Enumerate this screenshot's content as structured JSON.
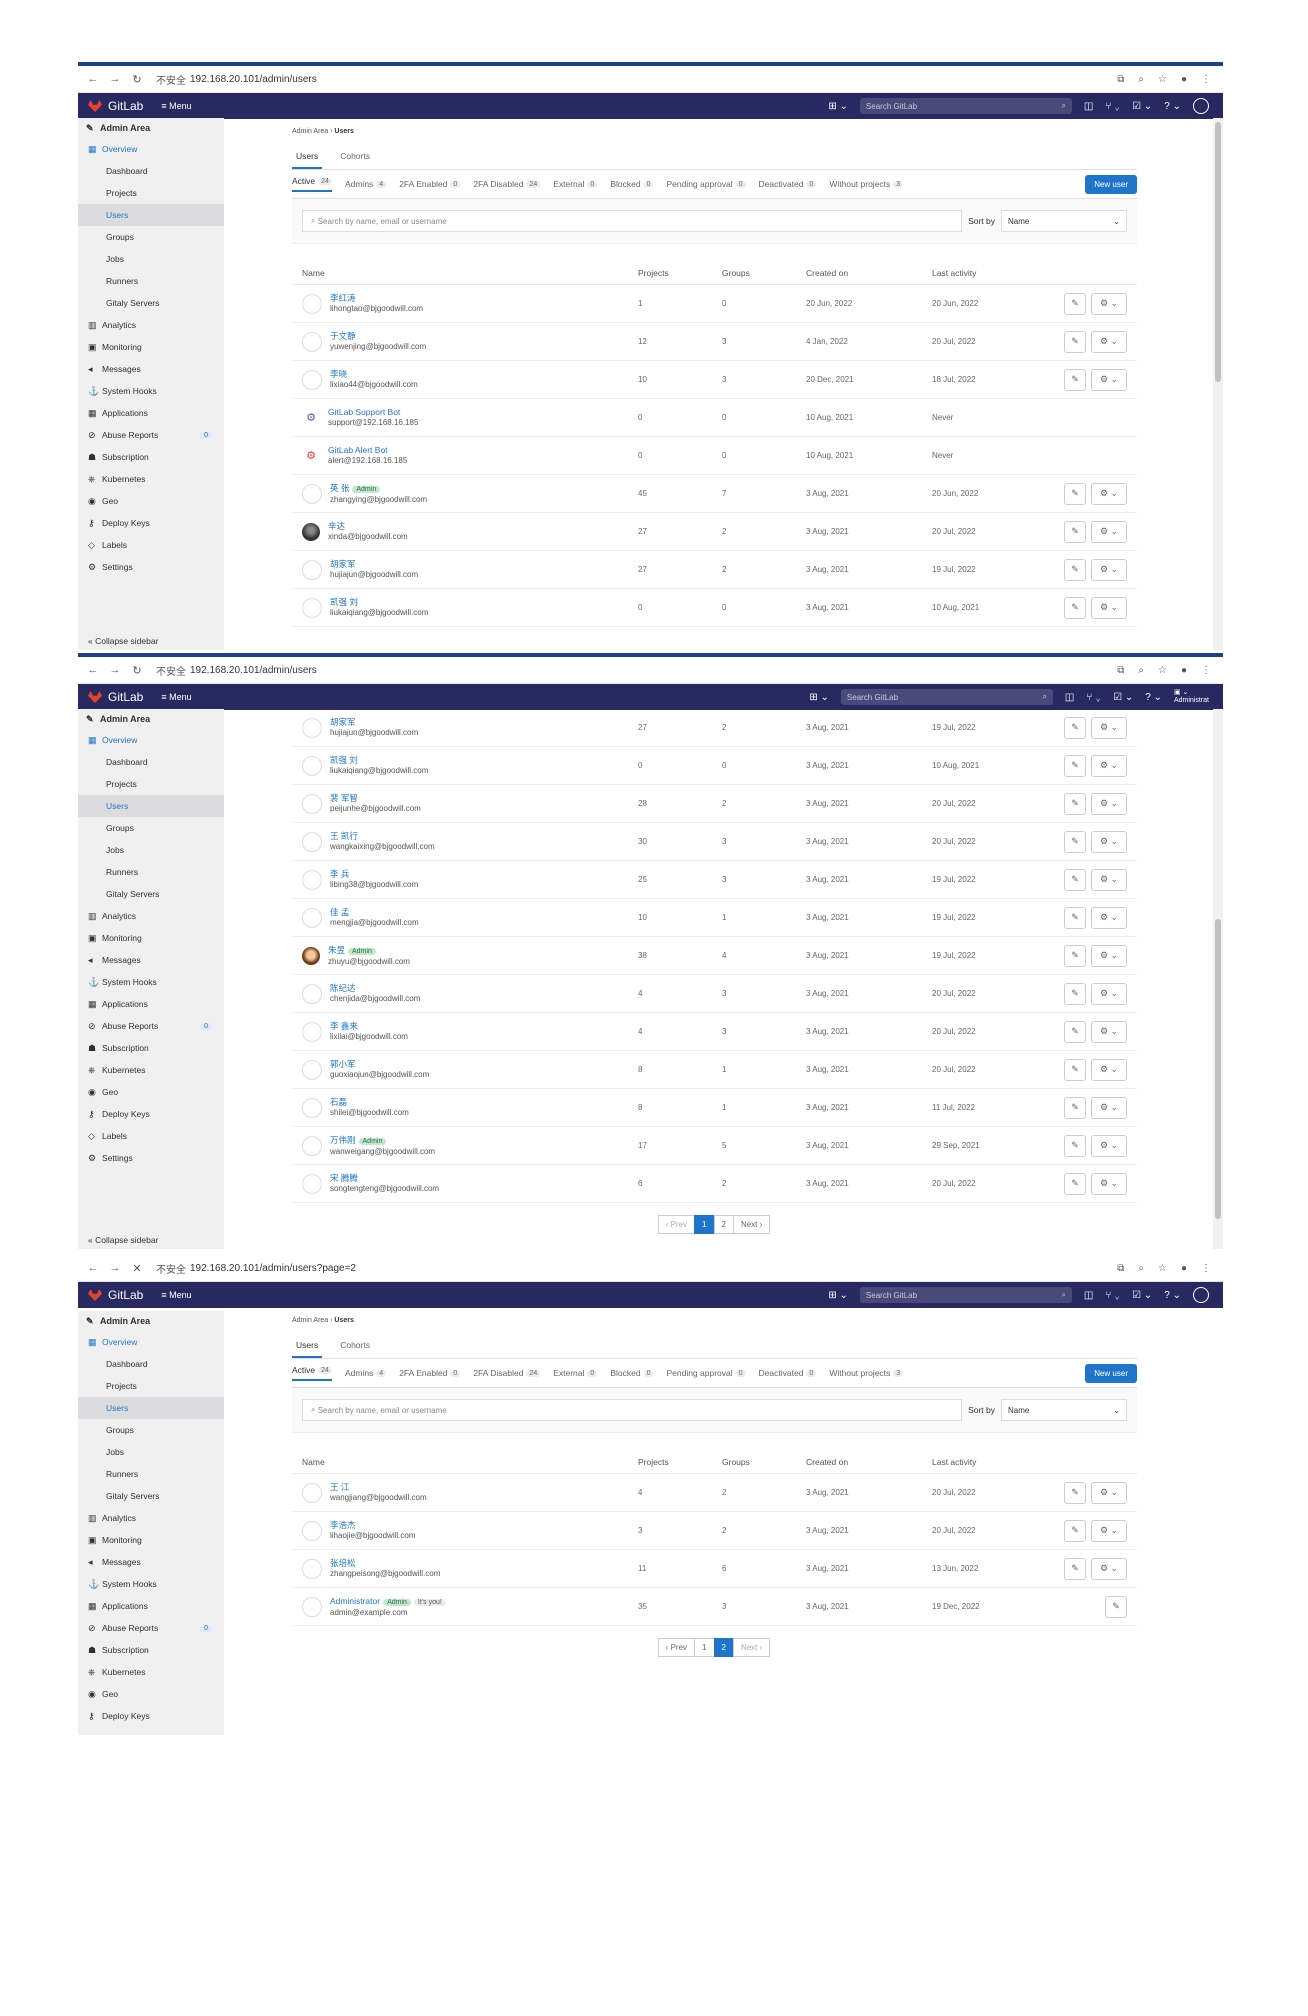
{
  "browser": {
    "url1": "192.168.20.101/admin/users",
    "url3": "192.168.20.101/admin/users?page=2",
    "security": "不安全"
  },
  "topbar": {
    "brand": "GitLab",
    "menu": "Menu",
    "search_placeholder": "Search GitLab",
    "admin_label": "Administrat"
  },
  "sidebar": {
    "title": "Admin Area",
    "overview": "Overview",
    "subitems": [
      "Dashboard",
      "Projects",
      "Users",
      "Groups",
      "Jobs",
      "Runners",
      "Gitaly Servers"
    ],
    "items": [
      "Analytics",
      "Monitoring",
      "Messages",
      "System Hooks",
      "Applications",
      "Abuse Reports",
      "Subscription",
      "Kubernetes",
      "Geo",
      "Deploy Keys",
      "Labels",
      "Settings"
    ],
    "abuse_count": "0",
    "collapse": "Collapse sidebar"
  },
  "breadcrumb": {
    "root": "Admin Area",
    "current": "Users"
  },
  "tabs": [
    "Users",
    "Cohorts"
  ],
  "filters": [
    {
      "label": "Active",
      "count": "24"
    },
    {
      "label": "Admins",
      "count": "4"
    },
    {
      "label": "2FA Enabled",
      "count": "0"
    },
    {
      "label": "2FA Disabled",
      "count": "24"
    },
    {
      "label": "External",
      "count": "0"
    },
    {
      "label": "Blocked",
      "count": "0"
    },
    {
      "label": "Pending approval",
      "count": "0"
    },
    {
      "label": "Deactivated",
      "count": "0"
    },
    {
      "label": "Without projects",
      "count": "3"
    }
  ],
  "new_user": "New user",
  "search_placeholder": "Search by name, email or username",
  "sort_label": "Sort by",
  "sort_value": "Name",
  "columns": [
    "Name",
    "Projects",
    "Groups",
    "Created on",
    "Last activity"
  ],
  "page1_rows": [
    {
      "name": "李红涛",
      "email": "lihongtao@bjgoodwill.com",
      "projects": "1",
      "groups": "0",
      "created": "20 Jun, 2022",
      "last": "20 Jun, 2022",
      "avatar": "blank"
    },
    {
      "name": "于文静",
      "email": "yuwenjing@bjgoodwill.com",
      "projects": "12",
      "groups": "3",
      "created": "4 Jan, 2022",
      "last": "20 Jul, 2022",
      "avatar": "blank"
    },
    {
      "name": "李晓",
      "email": "lixiao44@bjgoodwill.com",
      "projects": "10",
      "groups": "3",
      "created": "20 Dec, 2021",
      "last": "18 Jul, 2022",
      "avatar": "blank"
    },
    {
      "name": "GitLab Support Bot",
      "email": "support@192.168.16.185",
      "projects": "0",
      "groups": "0",
      "created": "10 Aug, 2021",
      "last": "Never",
      "avatar": "bot2"
    },
    {
      "name": "GitLab Alert Bot",
      "email": "alert@192.168.16.185",
      "projects": "0",
      "groups": "0",
      "created": "10 Aug, 2021",
      "last": "Never",
      "avatar": "bot"
    },
    {
      "name": "英 张",
      "email": "zhangying@bjgoodwill.com",
      "projects": "45",
      "groups": "7",
      "created": "3 Aug, 2021",
      "last": "20 Jun, 2022",
      "avatar": "blank",
      "admin": "Admin"
    },
    {
      "name": "辛达",
      "email": "xinda@bjgoodwill.com",
      "projects": "27",
      "groups": "2",
      "created": "3 Aug, 2021",
      "last": "20 Jul, 2022",
      "avatar": "dark"
    },
    {
      "name": "胡家军",
      "email": "hujiajun@bjgoodwill.com",
      "projects": "27",
      "groups": "2",
      "created": "3 Aug, 2021",
      "last": "19 Jul, 2022",
      "avatar": "blank"
    },
    {
      "name": "凯强 刘",
      "email": "liukaiqiang@bjgoodwill.com",
      "projects": "0",
      "groups": "0",
      "created": "3 Aug, 2021",
      "last": "10 Aug, 2021",
      "avatar": "blank"
    }
  ],
  "page1_more_rows": [
    {
      "name": "胡家军",
      "email": "hujiajun@bjgoodwill.com",
      "projects": "27",
      "groups": "2",
      "created": "3 Aug, 2021",
      "last": "19 Jul, 2022",
      "avatar": "blank"
    },
    {
      "name": "凯强 刘",
      "email": "liukaiqiang@bjgoodwill.com",
      "projects": "0",
      "groups": "0",
      "created": "3 Aug, 2021",
      "last": "10 Aug, 2021",
      "avatar": "blank"
    },
    {
      "name": "裴 军智",
      "email": "peijunhe@bjgoodwill.com",
      "projects": "28",
      "groups": "2",
      "created": "3 Aug, 2021",
      "last": "20 Jul, 2022",
      "avatar": "blank"
    },
    {
      "name": "王 凯行",
      "email": "wangkaixing@bjgoodwill.com",
      "projects": "30",
      "groups": "3",
      "created": "3 Aug, 2021",
      "last": "20 Jul, 2022",
      "avatar": "blank"
    },
    {
      "name": "李 兵",
      "email": "libing38@bjgoodwill.com",
      "projects": "25",
      "groups": "3",
      "created": "3 Aug, 2021",
      "last": "19 Jul, 2022",
      "avatar": "blank"
    },
    {
      "name": "佳 孟",
      "email": "mengjia@bjgoodwill.com",
      "projects": "10",
      "groups": "1",
      "created": "3 Aug, 2021",
      "last": "19 Jul, 2022",
      "avatar": "blank"
    },
    {
      "name": "朱昱",
      "email": "zhuyu@bjgoodwill.com",
      "projects": "38",
      "groups": "4",
      "created": "3 Aug, 2021",
      "last": "19 Jul, 2022",
      "avatar": "face",
      "admin": "Admin"
    },
    {
      "name": "陈纪达",
      "email": "chenjida@bjgoodwill.com",
      "projects": "4",
      "groups": "3",
      "created": "3 Aug, 2021",
      "last": "20 Jul, 2022",
      "avatar": "blank"
    },
    {
      "name": "李 鑫来",
      "email": "lixilai@bjgoodwill.com",
      "projects": "4",
      "groups": "3",
      "created": "3 Aug, 2021",
      "last": "20 Jul, 2022",
      "avatar": "blank"
    },
    {
      "name": "郭小军",
      "email": "guoxiaojun@bjgoodwill.com",
      "projects": "8",
      "groups": "1",
      "created": "3 Aug, 2021",
      "last": "20 Jul, 2022",
      "avatar": "blank"
    },
    {
      "name": "石磊",
      "email": "shilei@bjgoodwill.com",
      "projects": "8",
      "groups": "1",
      "created": "3 Aug, 2021",
      "last": "11 Jul, 2022",
      "avatar": "blank"
    },
    {
      "name": "万伟刚",
      "email": "wanweigang@bjgoodwill.com",
      "projects": "17",
      "groups": "5",
      "created": "3 Aug, 2021",
      "last": "29 Sep, 2021",
      "avatar": "blank",
      "admin": "Admin"
    },
    {
      "name": "宋 腾腾",
      "email": "songtengteng@bjgoodwill.com",
      "projects": "6",
      "groups": "2",
      "created": "3 Aug, 2021",
      "last": "20 Jul, 2022",
      "avatar": "blank"
    }
  ],
  "page2_rows": [
    {
      "name": "王 江",
      "email": "wangjiang@bjgoodwill.com",
      "projects": "4",
      "groups": "2",
      "created": "3 Aug, 2021",
      "last": "20 Jul, 2022",
      "avatar": "blank"
    },
    {
      "name": "李浩杰",
      "email": "lihaojie@bjgoodwill.com",
      "projects": "3",
      "groups": "2",
      "created": "3 Aug, 2021",
      "last": "20 Jul, 2022",
      "avatar": "blank"
    },
    {
      "name": "张培松",
      "email": "zhangpeisong@bjgoodwill.com",
      "projects": "11",
      "groups": "6",
      "created": "3 Aug, 2021",
      "last": "13 Jun, 2022",
      "avatar": "blank"
    },
    {
      "name": "Administrator",
      "email": "admin@example.com",
      "projects": "35",
      "groups": "3",
      "created": "3 Aug, 2021",
      "last": "19 Dec, 2022",
      "avatar": "blank",
      "admin": "Admin",
      "you": "It's you!",
      "edit_only": true
    }
  ],
  "pager": {
    "prev": "‹ Prev",
    "next": "Next ›",
    "p1": "1",
    "p2": "2"
  },
  "colors": {
    "topbar": "#292961",
    "accent": "#1f75cb",
    "admin_badge": "#c3e6cd"
  }
}
